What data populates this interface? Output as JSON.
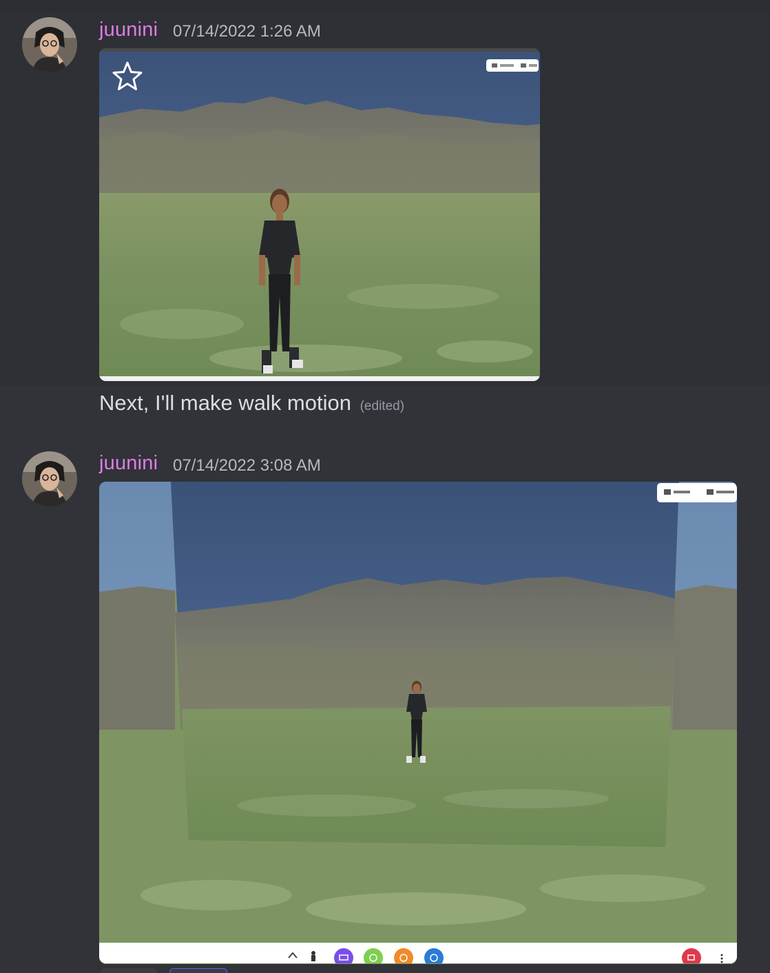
{
  "messages": [
    {
      "username": "juunini",
      "timestamp": "07/14/2022 1:26 AM",
      "attachment": {
        "overlay_chip": "",
        "has_star": true
      },
      "text": "Next, I'll make walk motion",
      "edited_label": "(edited)"
    },
    {
      "username": "juunini",
      "timestamp": "07/14/2022 3:08 AM",
      "attachment": {
        "overlay_chip_objects": "Objects",
        "overlay_chip_participants": "참가자 (1)"
      }
    }
  ],
  "colors": {
    "background": "#313338",
    "username": "#e07ce6",
    "timestamp": "#b5bac1",
    "text": "#dbdee1",
    "edited": "#949ba4"
  },
  "icons": [
    "star-icon",
    "chevron-up-icon",
    "avatar-figure-icon",
    "screen-share-icon",
    "emoji-green-icon",
    "emoji-orange-icon",
    "chat-bubble-icon",
    "leave-call-icon",
    "more-vertical-icon"
  ]
}
